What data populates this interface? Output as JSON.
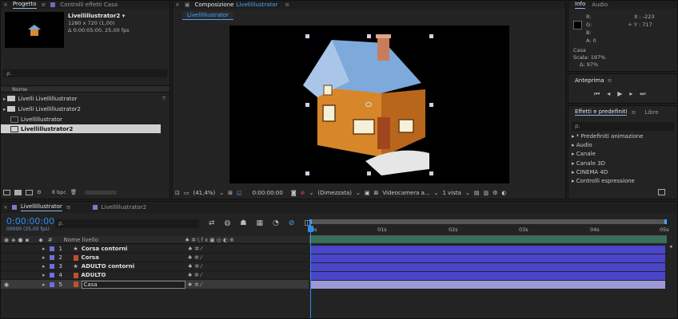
{
  "project": {
    "tab_label": "Progetto",
    "tab2_label": "Controlli effetti Casa",
    "comp_name": "Livellillustrator2 ▾",
    "comp_dims": "1280 x 720 (1,00)",
    "comp_duration": "Δ 0:00:05:00, 25,00 fps",
    "search_placeholder": "ρ.",
    "name_header": "Nome",
    "items": [
      {
        "label": "Livelli Livellillustrator",
        "type": "folder"
      },
      {
        "label": "Livelli Livellillustrator2",
        "type": "folder"
      },
      {
        "label": "Livellillustrator",
        "type": "comp"
      },
      {
        "label": "Livellillustrator2",
        "type": "comp"
      }
    ],
    "bpc": "8 bpc"
  },
  "composition": {
    "tab_label": "Composizione",
    "tab_name": "Livellillustrator",
    "subtab": "Livellillustrator",
    "zoom": "(41,4%)",
    "timecode": "0:00:00:00",
    "resolution": "(Dimezzata)",
    "camera": "Videocamera a...",
    "views": "1 vista"
  },
  "info": {
    "tab_info": "Info",
    "tab_audio": "Audio",
    "r": "R:",
    "g": "G:",
    "b": "B:",
    "a": "A:  0",
    "x": "X : -223",
    "y": "Y : 717",
    "layer": "Casa",
    "scale": "Scala: 197%",
    "delta": "Δ: 97%"
  },
  "preview": {
    "title": "Anteprima"
  },
  "effects": {
    "title": "Effetti e predefiniti",
    "libraries": "Libre",
    "search_placeholder": "ρ.",
    "items": [
      "* Predefiniti animazione",
      "Audio",
      "Canale",
      "Canale 3D",
      "CINEMA 4D",
      "Controlli espressione"
    ]
  },
  "timeline": {
    "tab1": "Livellillustrator",
    "tab2": "Livellillustrator2",
    "timecode": "0:00:00:00",
    "fps": "00000 (25,00 fps)",
    "search_placeholder": "ρ.",
    "col_num": "#",
    "col_name": "Nome livello",
    "ruler": [
      "0s",
      "01s",
      "02s",
      "03s",
      "04s",
      "05s"
    ],
    "layers": [
      {
        "num": "1",
        "name": "Corsa contorni",
        "icon": "star",
        "color": "#6f6fe0"
      },
      {
        "num": "2",
        "name": "Corsa",
        "icon": "ai",
        "color": "#6f6fe0"
      },
      {
        "num": "3",
        "name": "ADULTO contorni",
        "icon": "star",
        "color": "#6f6fe0"
      },
      {
        "num": "4",
        "name": "ADULTO",
        "icon": "ai",
        "color": "#6f6fe0"
      },
      {
        "num": "5",
        "name": "Casa",
        "icon": "ai",
        "color": "#6f6fe0"
      }
    ]
  },
  "colors": {
    "accent": "#2d8ceb",
    "layer_bar": "#4a45c9",
    "layer_bar_sel": "#9c98d8"
  }
}
